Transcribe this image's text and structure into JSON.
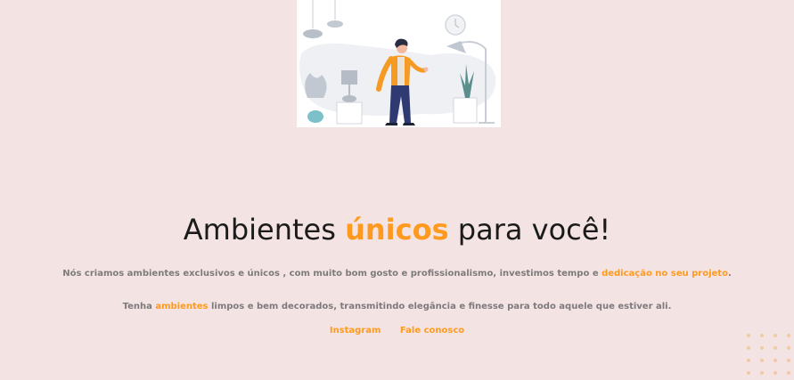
{
  "headline": {
    "before": "Ambientes ",
    "accent": "únicos",
    "after": " para você!"
  },
  "paragraph1": {
    "text": "Nós criamos ambientes exclusivos e únicos , com muito bom gosto e profissionalismo, investimos tempo e ",
    "accent": "dedicação no seu projeto",
    "end": "."
  },
  "paragraph2": {
    "start": "Tenha ",
    "accent": "ambientes",
    "text": " limpos e bem decorados, transmitindo elegância e finesse para todo aquele que estiver ali."
  },
  "links": {
    "instagram": "Instagram",
    "contact": "Fale conosco"
  },
  "colors": {
    "background": "#f4e3e3",
    "accent": "#ff9a1f",
    "text": "#7d7a7c",
    "heading": "#1b1b1b"
  },
  "illustration": "person-in-living-room-illustration",
  "decoration": "dot-grid-pattern"
}
